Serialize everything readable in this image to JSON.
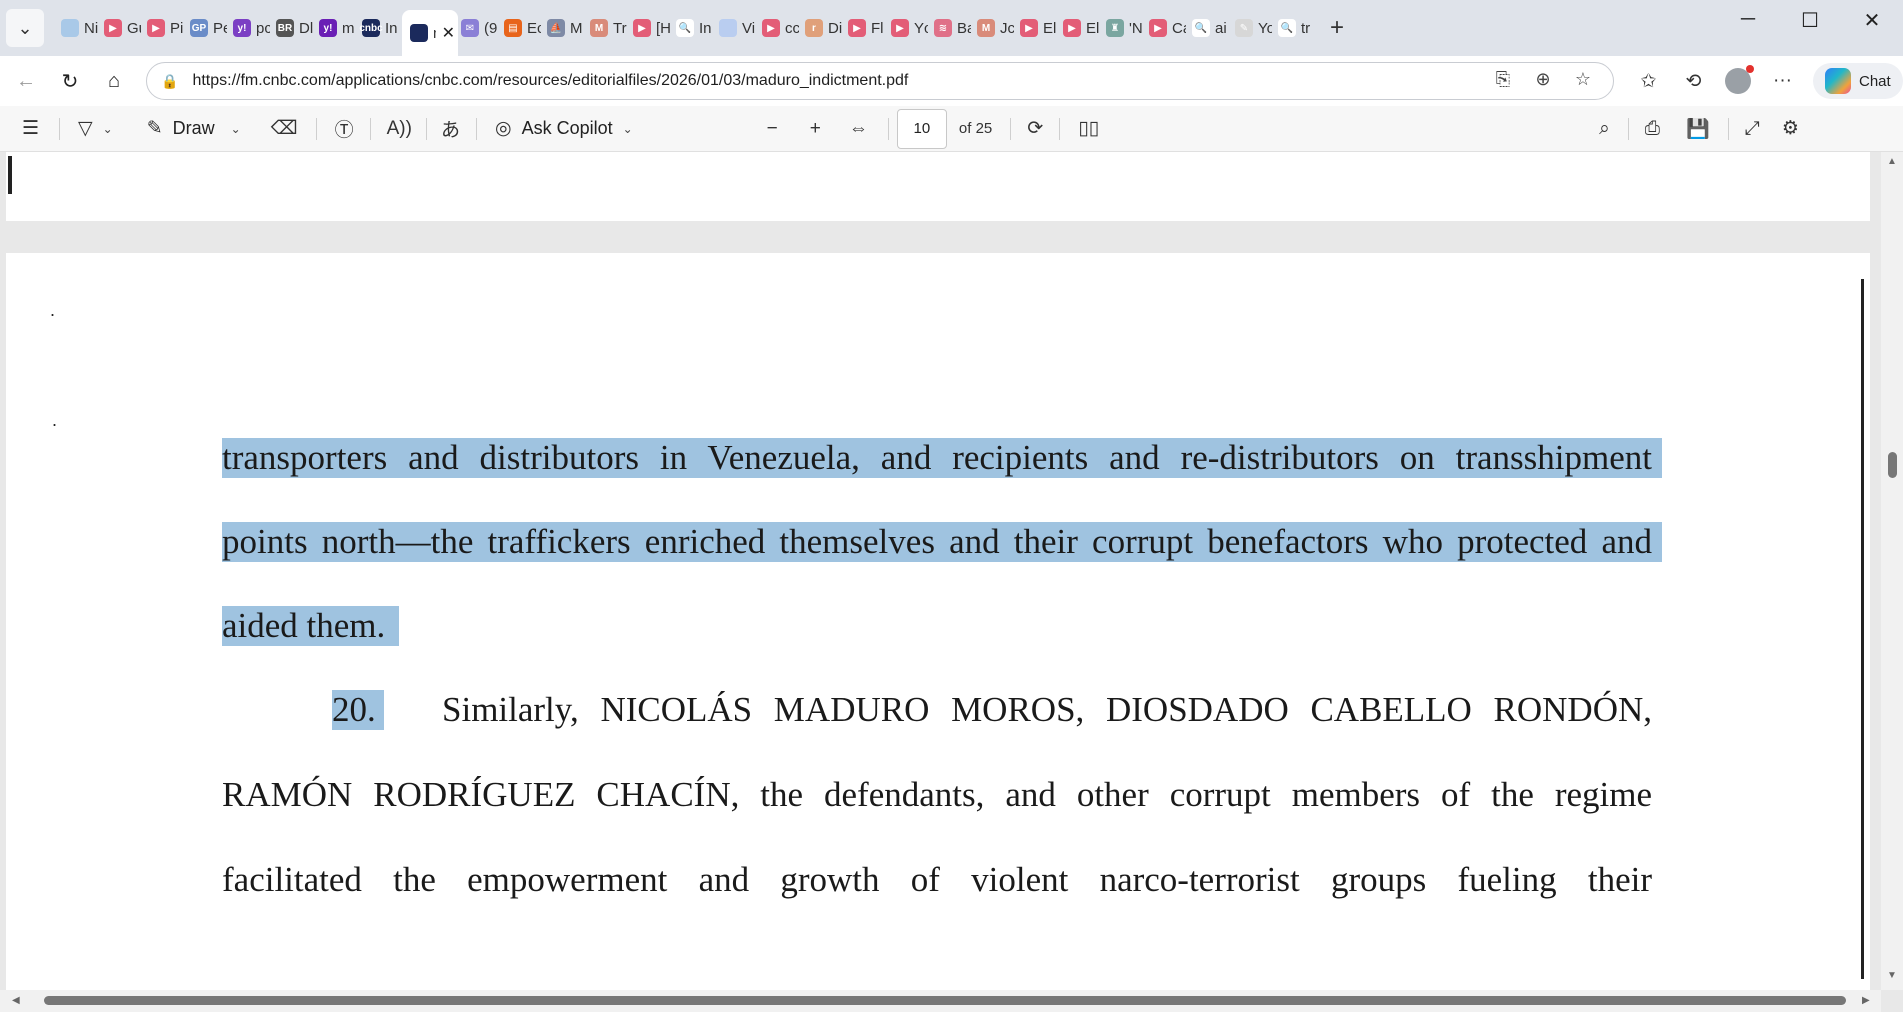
{
  "tabs": [
    {
      "label": "Ni",
      "color": "#a9c9e8",
      "glyph": ""
    },
    {
      "label": "Gu",
      "color": "#e35d77",
      "glyph": "▶"
    },
    {
      "label": "Pi",
      "color": "#e35d77",
      "glyph": "▶"
    },
    {
      "label": "Pe",
      "color": "#6a8cc8",
      "glyph": "GP"
    },
    {
      "label": "pc",
      "color": "#7b3fc4",
      "glyph": "y!"
    },
    {
      "label": "Dl",
      "color": "#555555",
      "glyph": "BR"
    },
    {
      "label": "m",
      "color": "#6a1fb5",
      "glyph": "y!"
    },
    {
      "label": "In",
      "color": "#1b2a5c",
      "glyph": "cnbc"
    },
    {
      "label": "(9",
      "color": "#8a7fd6",
      "glyph": "✉"
    },
    {
      "label": "Ec",
      "color": "#e8641b",
      "glyph": "▤"
    },
    {
      "label": "M",
      "color": "#7e8aa6",
      "glyph": "⛵"
    },
    {
      "label": "Tr",
      "color": "#d98b7a",
      "glyph": "M"
    },
    {
      "label": "[H",
      "color": "#e35d77",
      "glyph": "▶"
    },
    {
      "label": "In",
      "color": "#ffffff",
      "glyph": "🔍"
    },
    {
      "label": "Vi",
      "color": "#b9cdf0",
      "glyph": ""
    },
    {
      "label": "cc",
      "color": "#e35d77",
      "glyph": "▶"
    },
    {
      "label": "Di",
      "color": "#e0a07a",
      "glyph": "r"
    },
    {
      "label": "Fl",
      "color": "#e35d77",
      "glyph": "▶"
    },
    {
      "label": "Yc",
      "color": "#e35d77",
      "glyph": "▶"
    },
    {
      "label": "Ba",
      "color": "#e07088",
      "glyph": "≋"
    },
    {
      "label": "Jc",
      "color": "#d98b7a",
      "glyph": "M"
    },
    {
      "label": "El",
      "color": "#e35d77",
      "glyph": "▶"
    },
    {
      "label": "El",
      "color": "#e35d77",
      "glyph": "▶"
    },
    {
      "label": "'N",
      "color": "#7aa6a0",
      "glyph": "♜"
    },
    {
      "label": "Ca",
      "color": "#e35d77",
      "glyph": "▶"
    },
    {
      "label": "ai",
      "color": "#ffffff",
      "glyph": "🔍"
    },
    {
      "label": "Yo",
      "color": "#d7d7d7",
      "glyph": "✎"
    },
    {
      "label": "tr",
      "color": "#ffffff",
      "glyph": "🔍"
    }
  ],
  "active_tab": {
    "label": "m",
    "favicon_color": "#1b2a5c",
    "close": "✕"
  },
  "active_tab_index": 8,
  "address_bar": {
    "url": "https://fm.cnbc.com/applications/cnbc.com/resources/editorialfiles/2026/01/03/maduro_indictment.pdf"
  },
  "chat_label": "Chat",
  "pdf_toolbar": {
    "draw_label": "Draw",
    "copilot_label": "Ask Copilot",
    "page_number": "10",
    "page_total": "of 25"
  },
  "document": {
    "line1": "transporters and distributors in Venezuela, and recipients and re-distributors on transshipment",
    "line2": "points north—the traffickers enriched themselves and their corrupt benefactors who protected and",
    "line3": "aided them.",
    "para_number": "20.",
    "line4": "Similarly, NICOLÁS MADURO MOROS, DIOSDADO CABELLO RONDÓN,",
    "line5": "RAMÓN RODRÍGUEZ CHACÍN, the defendants, and other corrupt members of the regime",
    "line6": "facilitated the empowerment and growth of violent narco-terrorist groups fueling their"
  },
  "colors": {
    "selection_highlight": "#9fc3e0",
    "tabstrip_bg": "#dfe3ea",
    "viewer_bg": "#e8e8e8"
  }
}
